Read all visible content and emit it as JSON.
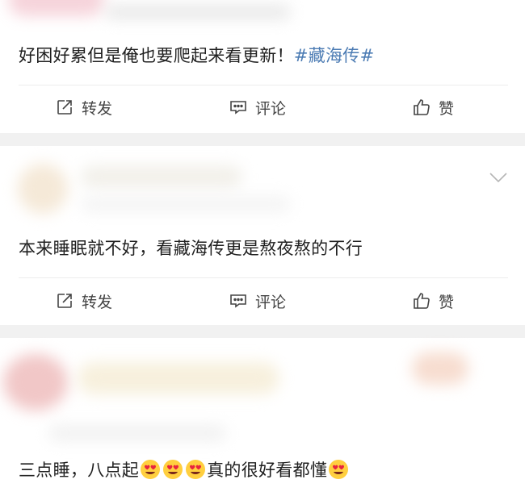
{
  "posts": [
    {
      "text": "好困好累但是俺也要爬起来看更新！",
      "hashtag": "#藏海传#",
      "actions": {
        "repost": "转发",
        "comment": "评论",
        "like": "赞"
      }
    },
    {
      "text": "本来睡眠就不好，看藏海传更是熬夜熬的不行",
      "actions": {
        "repost": "转发",
        "comment": "评论",
        "like": "赞"
      }
    },
    {
      "text_parts": [
        "三点睡，八点起",
        "真的很好看都懂"
      ],
      "emoji": "heart-eyes-face"
    }
  ],
  "colors": {
    "hashtag": "#4b7bb3",
    "separator": "#f1f1f1"
  },
  "icons": {
    "repost": "share-edit-icon",
    "comment": "comment-icon",
    "like": "thumbs-up-icon",
    "more": "chevron-down-icon"
  }
}
